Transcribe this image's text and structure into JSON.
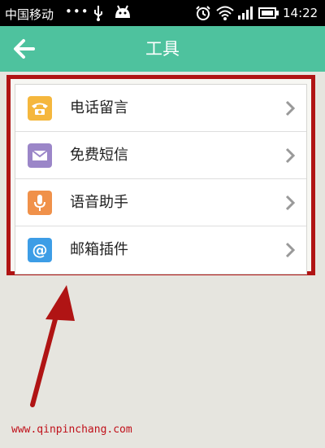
{
  "status_bar": {
    "carrier": "中国移动",
    "dots": "•••",
    "time": "14:22"
  },
  "header": {
    "title": "工具"
  },
  "tools": [
    {
      "label": "电话留言",
      "icon": "phone-icon",
      "color": "#f5b73d"
    },
    {
      "label": "免费短信",
      "icon": "envelope-icon",
      "color": "#9b86c8"
    },
    {
      "label": "语音助手",
      "icon": "microphone-icon",
      "color": "#f0914a"
    },
    {
      "label": "邮箱插件",
      "icon": "at-sign-icon",
      "color": "#3d9de6"
    }
  ],
  "colors": {
    "header": "#4ec29e",
    "highlight_border": "#b01414",
    "arrow": "#b01414"
  },
  "watermark": "www.qinpinchang.com"
}
